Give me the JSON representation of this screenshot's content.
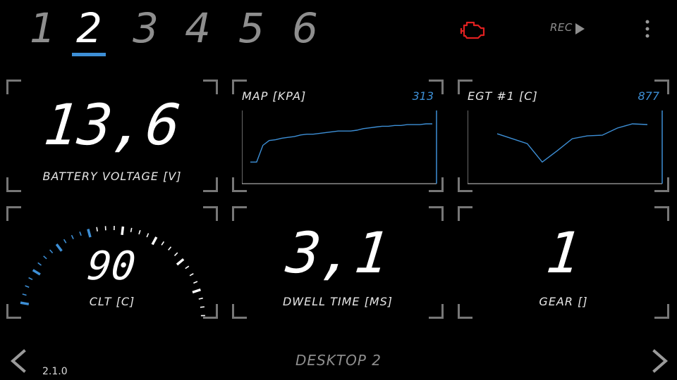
{
  "tabs": [
    {
      "label": "1",
      "active": false
    },
    {
      "label": "2",
      "active": true
    },
    {
      "label": "3",
      "active": false
    },
    {
      "label": "4",
      "active": false
    },
    {
      "label": "5",
      "active": false
    },
    {
      "label": "6",
      "active": false
    }
  ],
  "topbar": {
    "rec_label": "REC",
    "engine_icon": "check-engine-icon",
    "engine_icon_color": "#e02020"
  },
  "tiles": {
    "battery": {
      "value": "13,6",
      "label": "BATTERY VOLTAGE [V]"
    },
    "map": {
      "title": "MAP [KPA]",
      "value": "313",
      "series": [
        35,
        35,
        56,
        62,
        63,
        65,
        66,
        67,
        69,
        70,
        70,
        71,
        72,
        73,
        74,
        74,
        74,
        75,
        77,
        78,
        79,
        80,
        80,
        81,
        81,
        82,
        82,
        82,
        83,
        83
      ]
    },
    "egt": {
      "title": "EGT #1 [C]",
      "value": "877",
      "series": [
        850,
        843,
        836,
        810,
        826,
        843,
        847,
        848,
        858,
        864,
        863
      ]
    },
    "clt": {
      "value": "90",
      "label": "CLT [C]"
    },
    "dwell": {
      "value": "3,1",
      "label": "DWELL TIME [MS]"
    },
    "gear": {
      "value": "1",
      "label": "GEAR []"
    }
  },
  "footer": {
    "desktop_label": "DESKTOP 2",
    "version": "2.1.0"
  },
  "colors": {
    "accent": "#3d8fd6",
    "text_dim": "#8e8e8e",
    "alert": "#e02020"
  }
}
